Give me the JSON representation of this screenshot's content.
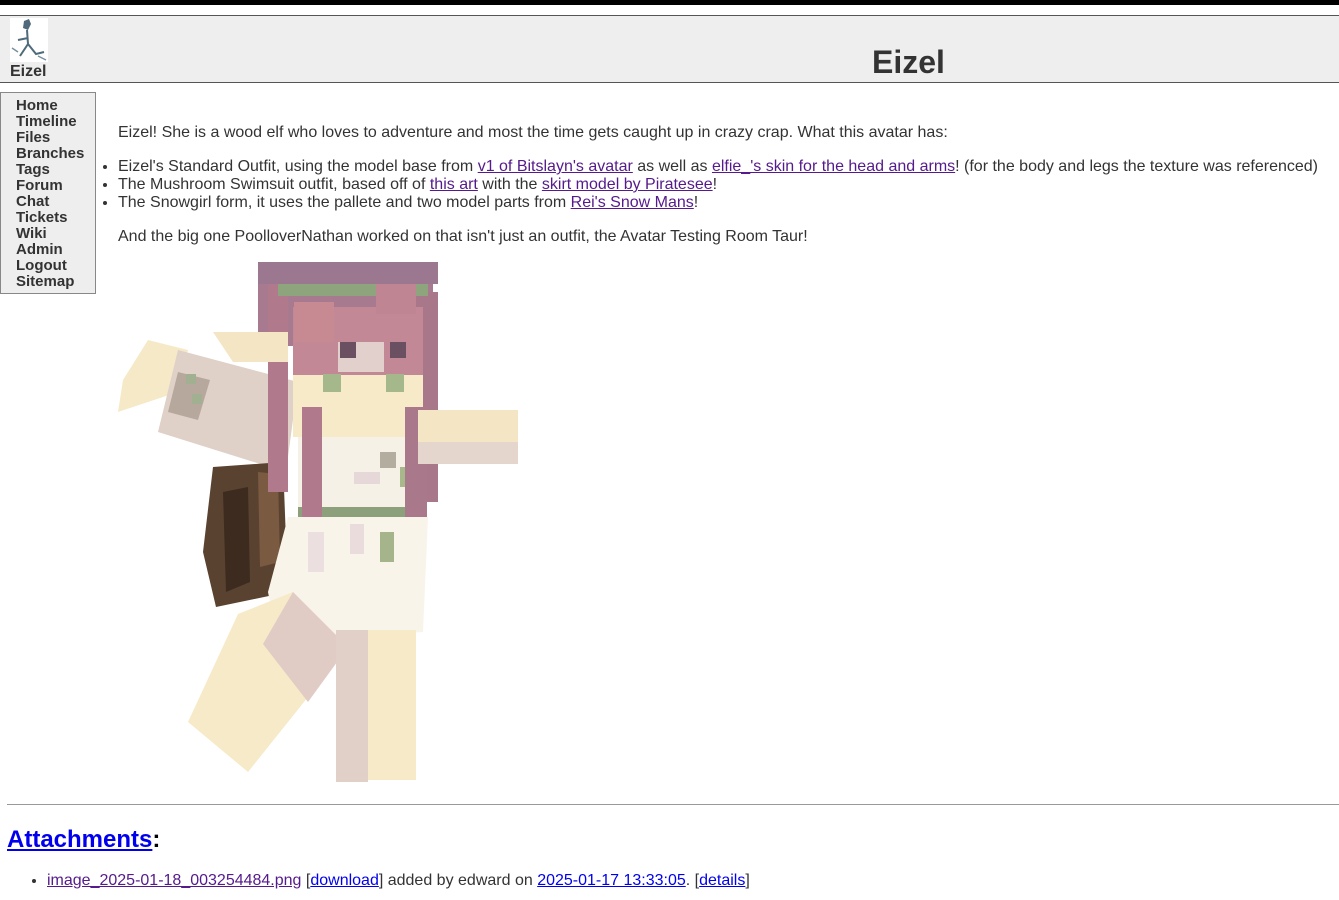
{
  "header": {
    "logo_label": "Eizel",
    "title": "Eizel"
  },
  "nav": {
    "items": [
      {
        "label": "Home"
      },
      {
        "label": "Timeline"
      },
      {
        "label": "Files"
      },
      {
        "label": "Branches"
      },
      {
        "label": "Tags"
      },
      {
        "label": "Forum"
      },
      {
        "label": "Chat"
      },
      {
        "label": "Tickets"
      },
      {
        "label": "Wiki"
      },
      {
        "label": "Admin"
      },
      {
        "label": "Logout"
      },
      {
        "label": "Sitemap"
      }
    ]
  },
  "content": {
    "intro": "Eizel! She is a wood elf who loves to adventure and most the time gets caught up in crazy crap. What this avatar has:",
    "items": [
      {
        "t1": "Eizel's Standard Outfit, using the model base from ",
        "l1": "v1 of Bitslayn's avatar",
        "t2": " as well as ",
        "l2": "elfie_'s skin for the head and arms",
        "t3": "! (for the body and legs the texture was referenced)"
      },
      {
        "t1": "The Mushroom Swimsuit outfit, based off of ",
        "l1": "this art",
        "t2": " with the ",
        "l2": "skirt model by Piratesee",
        "t3": "!"
      },
      {
        "t1": "The Snowgirl form, it uses the pallete and two model parts from ",
        "l1": "Rei's Snow Mans",
        "t2": "!"
      }
    ],
    "outro": "And the big one PoolloverNathan worked on that isn't just an outfit, the Avatar Testing Room Taur!"
  },
  "attachments": {
    "heading": "Attachments",
    "colon": ":",
    "files": [
      {
        "name": "image_2025-01-18_003254484.png",
        "bracket_open": " [",
        "download": "download",
        "added_by": "] added by edward on ",
        "date": "2025-01-17 13:33:05",
        "sep": ". [",
        "details": "details",
        "bracket_close": "]"
      }
    ]
  }
}
